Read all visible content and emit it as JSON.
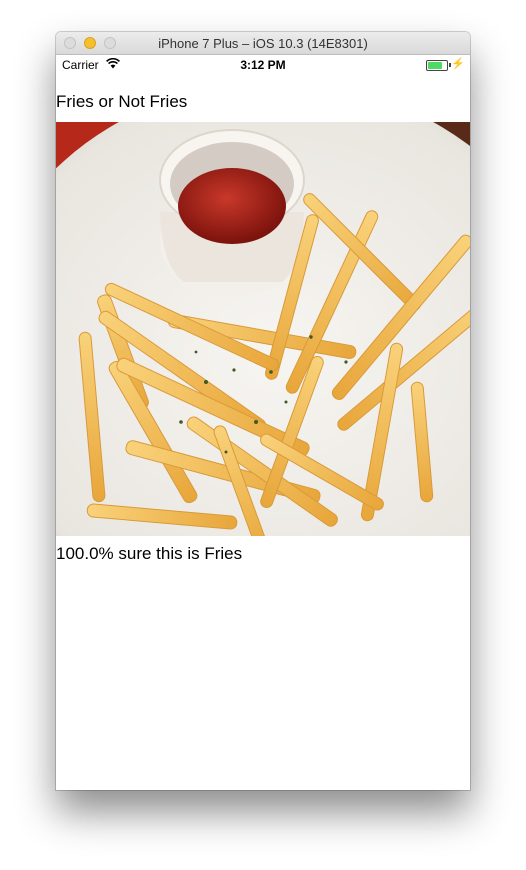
{
  "window": {
    "title": "iPhone 7 Plus – iOS 10.3 (14E8301)"
  },
  "status_bar": {
    "carrier": "Carrier",
    "time": "3:12 PM",
    "wifi_icon": "wifi-icon",
    "battery_icon": "battery-icon",
    "charging_icon": "bolt-icon",
    "battery_color": "#4cd964"
  },
  "app": {
    "title": "Fries or Not Fries",
    "image_icon": "fries-photo",
    "result": "100.0% sure this is Fries"
  }
}
